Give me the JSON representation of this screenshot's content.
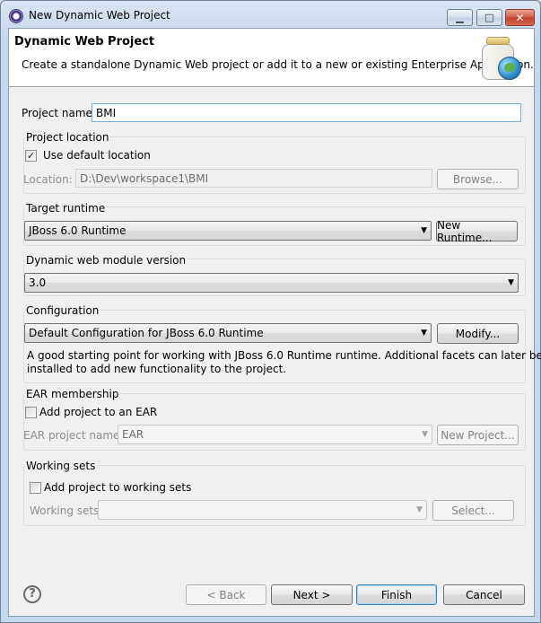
{
  "window": {
    "title": "New Dynamic Web Project",
    "controls": {
      "minimize": "▁",
      "maximize": "□",
      "close": "✕"
    }
  },
  "header": {
    "title": "Dynamic Web Project",
    "description": "Create a standalone Dynamic Web project or add it to a new or existing Enterprise Application.",
    "icon": "jar-globe-icon"
  },
  "project_name": {
    "label": "Project name:",
    "value": "BMI"
  },
  "project_location": {
    "title": "Project location",
    "use_default_label": "Use default location",
    "use_default_checked": "✓",
    "location_label": "Location:",
    "location_value": "D:\\Dev\\workspace1\\BMI",
    "browse_label": "Browse..."
  },
  "target_runtime": {
    "title": "Target runtime",
    "selected": "JBoss 6.0 Runtime",
    "new_runtime_label": "New Runtime..."
  },
  "module_version": {
    "title": "Dynamic web module version",
    "selected": "3.0"
  },
  "configuration": {
    "title": "Configuration",
    "selected": "Default Configuration for JBoss 6.0 Runtime",
    "modify_label": "Modify...",
    "description_line1": "A good starting point for working with JBoss 6.0 Runtime runtime. Additional facets can later be",
    "description_line2": "installed to add new functionality to the project."
  },
  "ear": {
    "title": "EAR membership",
    "add_label": "Add project to an EAR",
    "project_name_label": "EAR project name:",
    "project_name_value": "EAR",
    "new_project_label": "New Project..."
  },
  "working_sets": {
    "title": "Working sets",
    "add_label": "Add project to working sets",
    "sets_label": "Working sets:",
    "sets_value": "",
    "select_label": "Select..."
  },
  "footer": {
    "help": "?",
    "back_label": "< Back",
    "next_label": "Next >",
    "finish_label": "Finish",
    "cancel_label": "Cancel"
  },
  "arrow": "▼"
}
